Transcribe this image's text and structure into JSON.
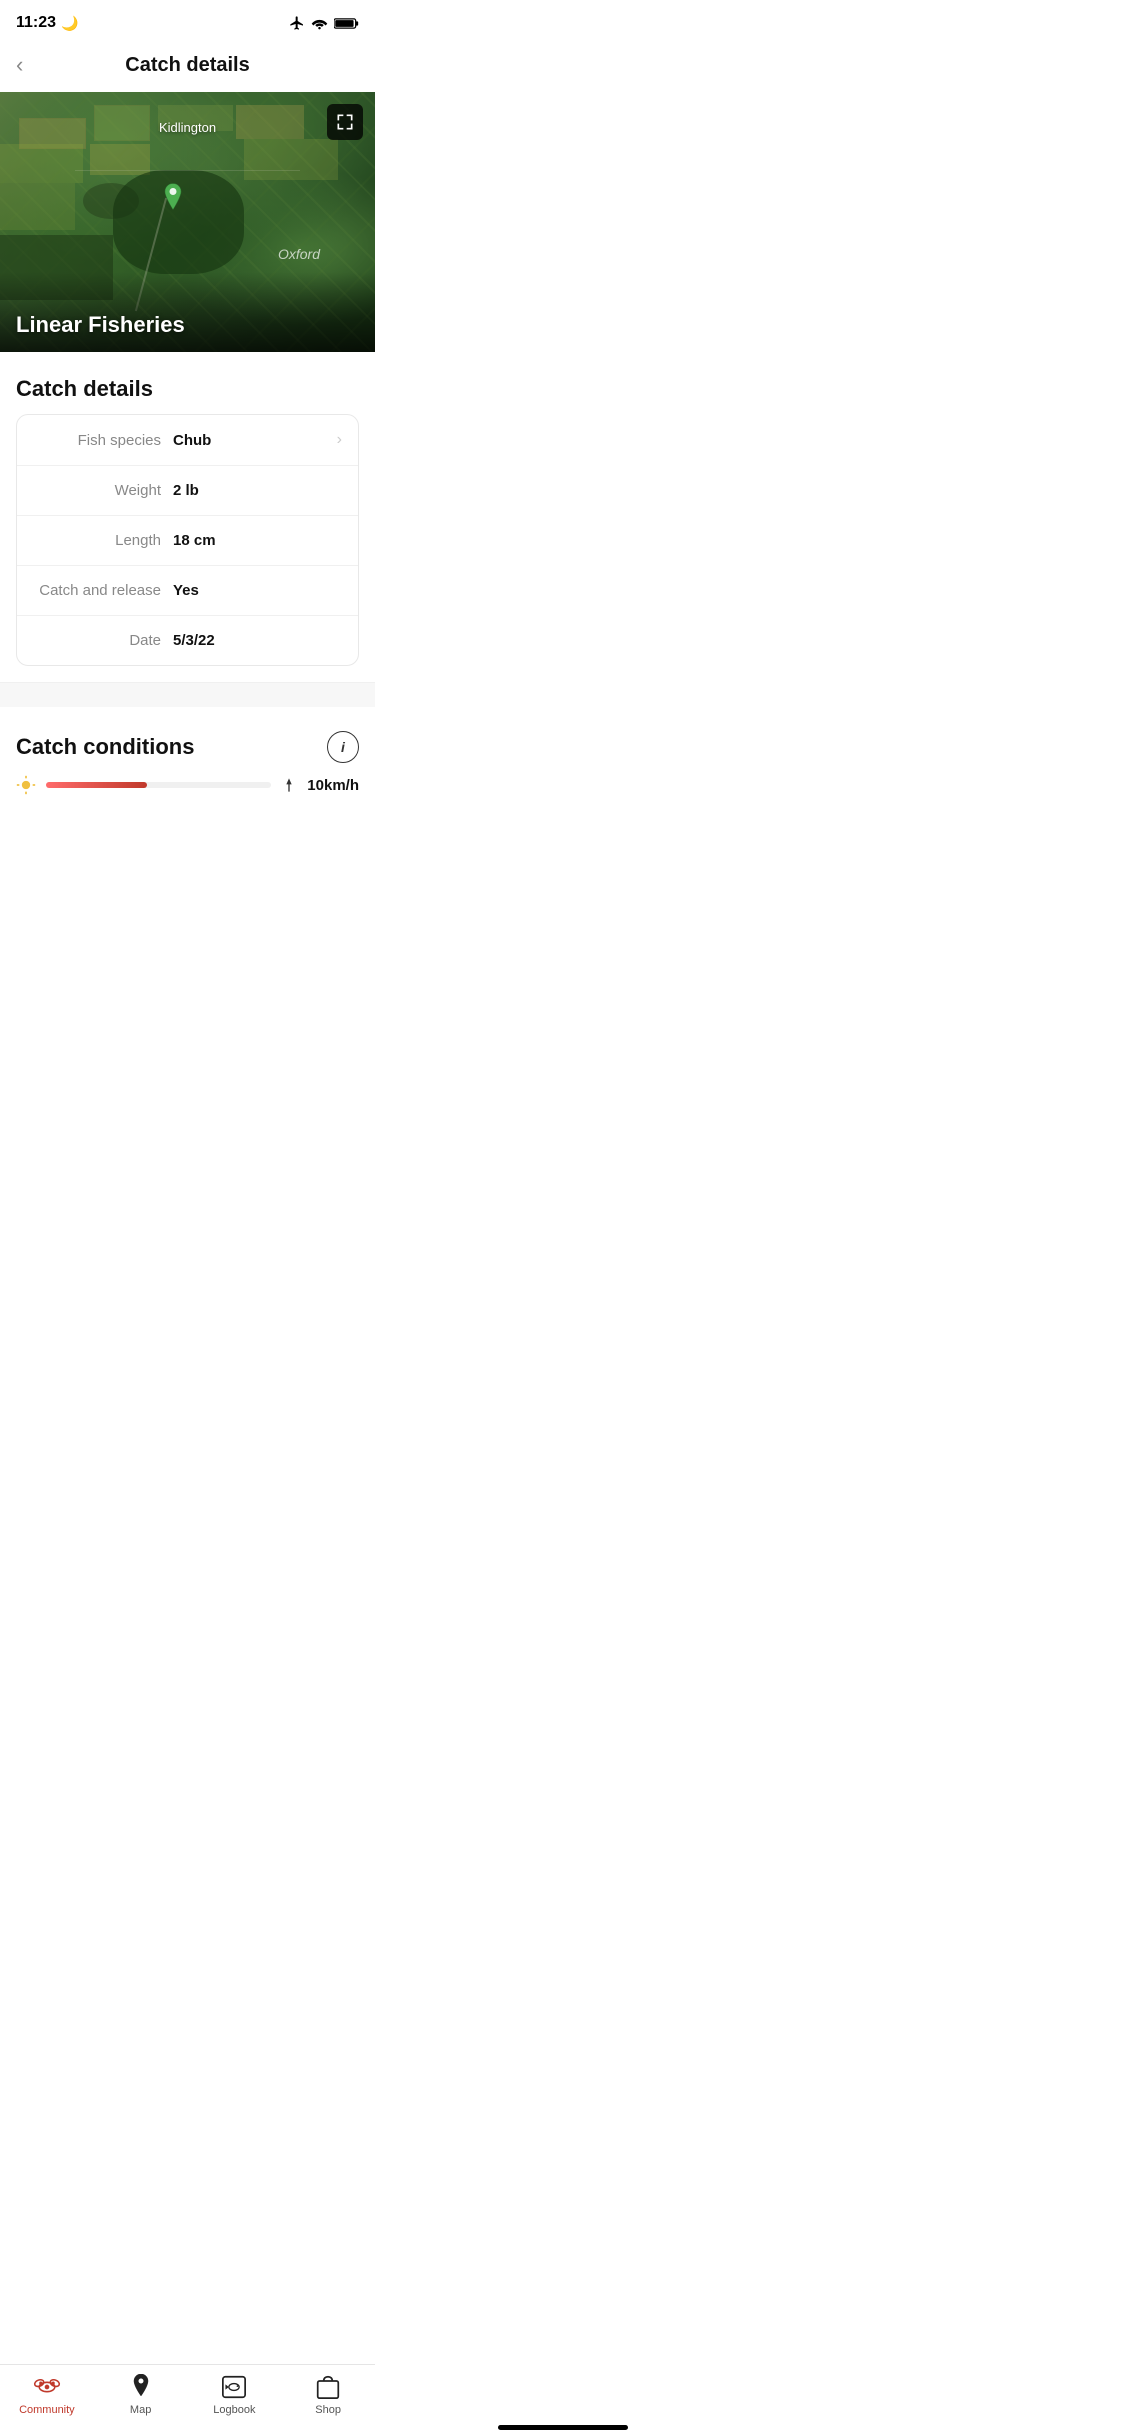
{
  "statusBar": {
    "time": "11:23",
    "moonIcon": "🌙"
  },
  "header": {
    "backLabel": "‹",
    "title": "Catch details"
  },
  "map": {
    "locationLabel": "Kidlington",
    "fisheryName": "Linear Fisheries",
    "oxfordLabel": "Oxford",
    "expandIconTitle": "expand"
  },
  "catchDetails": {
    "sectionTitle": "Catch details",
    "rows": [
      {
        "label": "Fish species",
        "value": "Chub",
        "hasChevron": true
      },
      {
        "label": "Weight",
        "value": "2 lb",
        "hasChevron": false
      },
      {
        "label": "Length",
        "value": "18 cm",
        "hasChevron": false
      },
      {
        "label": "Catch and release",
        "value": "Yes",
        "hasChevron": false
      },
      {
        "label": "Date",
        "value": "5/3/22",
        "hasChevron": false
      }
    ]
  },
  "catchConditions": {
    "sectionTitle": "Catch conditions",
    "infoLabel": "i",
    "windSpeed": "10km/h"
  },
  "bottomNav": {
    "items": [
      {
        "id": "community",
        "label": "Community",
        "active": true
      },
      {
        "id": "map",
        "label": "Map",
        "active": false
      },
      {
        "id": "logbook",
        "label": "Logbook",
        "active": false
      },
      {
        "id": "shop",
        "label": "Shop",
        "active": false
      }
    ]
  }
}
